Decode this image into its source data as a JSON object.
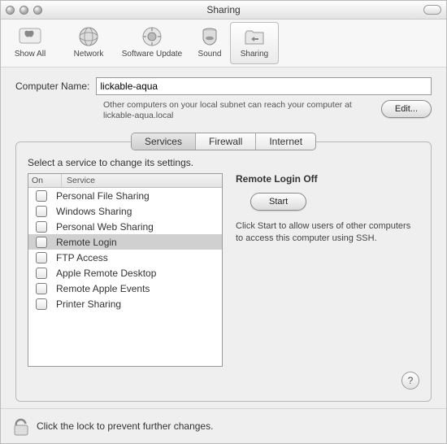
{
  "window": {
    "title": "Sharing"
  },
  "toolbar": {
    "items": [
      {
        "label": "Show All",
        "icon": "apple-icon"
      },
      {
        "label": "Network",
        "icon": "globe-icon"
      },
      {
        "label": "Software Update",
        "icon": "update-icon"
      },
      {
        "label": "Sound",
        "icon": "speaker-icon"
      },
      {
        "label": "Sharing",
        "icon": "folder-share-icon",
        "selected": true
      }
    ]
  },
  "computer_name": {
    "label": "Computer Name:",
    "value": "lickable-aqua",
    "subtext": "Other computers on your local subnet can reach your computer at lickable-aqua.local",
    "edit_label": "Edit..."
  },
  "tabs": {
    "items": [
      {
        "label": "Services",
        "active": true
      },
      {
        "label": "Firewall",
        "active": false
      },
      {
        "label": "Internet",
        "active": false
      }
    ]
  },
  "services_panel": {
    "instruction": "Select a service to change its settings.",
    "columns": {
      "on": "On",
      "service": "Service"
    },
    "services": [
      {
        "name": "Personal File Sharing",
        "on": false,
        "selected": false
      },
      {
        "name": "Windows Sharing",
        "on": false,
        "selected": false
      },
      {
        "name": "Personal Web Sharing",
        "on": false,
        "selected": false
      },
      {
        "name": "Remote Login",
        "on": false,
        "selected": true
      },
      {
        "name": "FTP Access",
        "on": false,
        "selected": false
      },
      {
        "name": "Apple Remote Desktop",
        "on": false,
        "selected": false
      },
      {
        "name": "Remote Apple Events",
        "on": false,
        "selected": false
      },
      {
        "name": "Printer Sharing",
        "on": false,
        "selected": false
      }
    ],
    "detail": {
      "title": "Remote Login Off",
      "action_label": "Start",
      "description": "Click Start to allow users of other computers to access this computer using SSH."
    }
  },
  "help": {
    "label": "?"
  },
  "lock": {
    "text": "Click the lock to prevent further changes."
  }
}
